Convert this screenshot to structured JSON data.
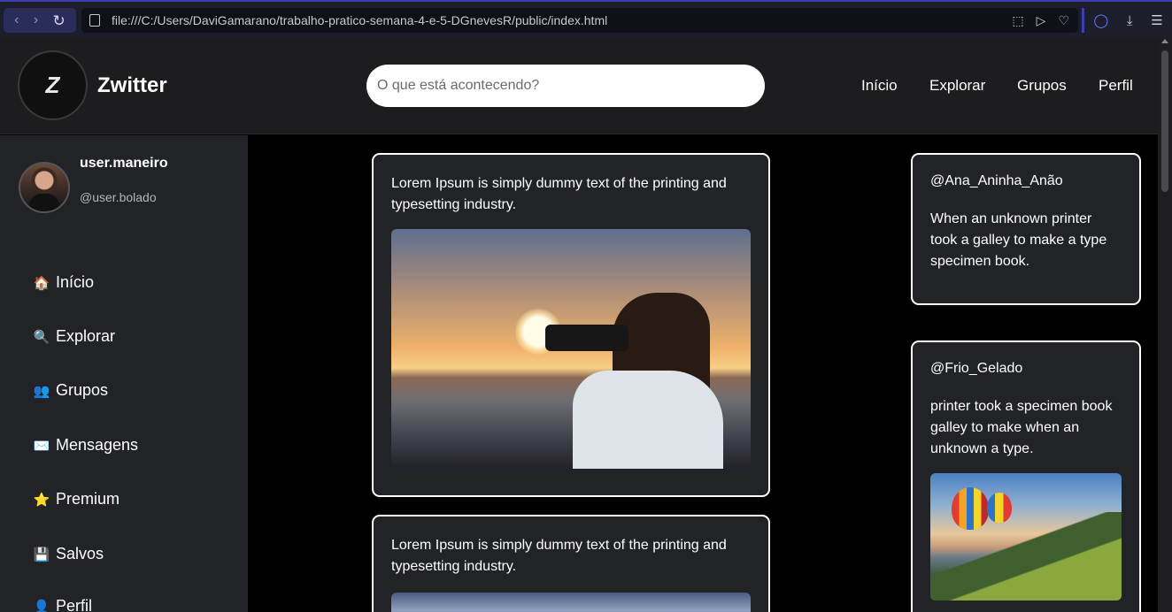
{
  "browser": {
    "url": "file:///C:/Users/DaviGamarano/trabalho-pratico-semana-4-e-5-DGnevesR/public/index.html"
  },
  "header": {
    "logo_letter": "Z",
    "brand": "Zwitter",
    "search_placeholder": "O que está acontecendo?",
    "nav": [
      "Início",
      "Explorar",
      "Grupos",
      "Perfil"
    ]
  },
  "profile": {
    "username": "user.maneiro",
    "handle": "@user.bolado"
  },
  "sidebar": {
    "items": [
      {
        "icon": "🏠",
        "label": "Início"
      },
      {
        "icon": "🔍",
        "label": "Explorar"
      },
      {
        "icon": "👥",
        "label": "Grupos"
      },
      {
        "icon": "✉️",
        "label": "Mensagens"
      },
      {
        "icon": "⭐",
        "label": "Premium"
      },
      {
        "icon": "💾",
        "label": "Salvos"
      },
      {
        "icon": "👤",
        "label": "Perfil"
      }
    ]
  },
  "feed": {
    "posts": [
      {
        "text": "Lorem Ipsum is simply dummy text of the printing and typesetting industry."
      },
      {
        "text": "Lorem Ipsum is simply dummy text of the printing and typesetting industry."
      }
    ]
  },
  "trending": {
    "posts": [
      {
        "handle": "@Ana_Aninha_Anão",
        "text": "When an unknown printer took a galley to make a type specimen book."
      },
      {
        "handle": "@Frio_Gelado",
        "text": "printer took a specimen book galley to make when an unknown a type."
      }
    ]
  }
}
